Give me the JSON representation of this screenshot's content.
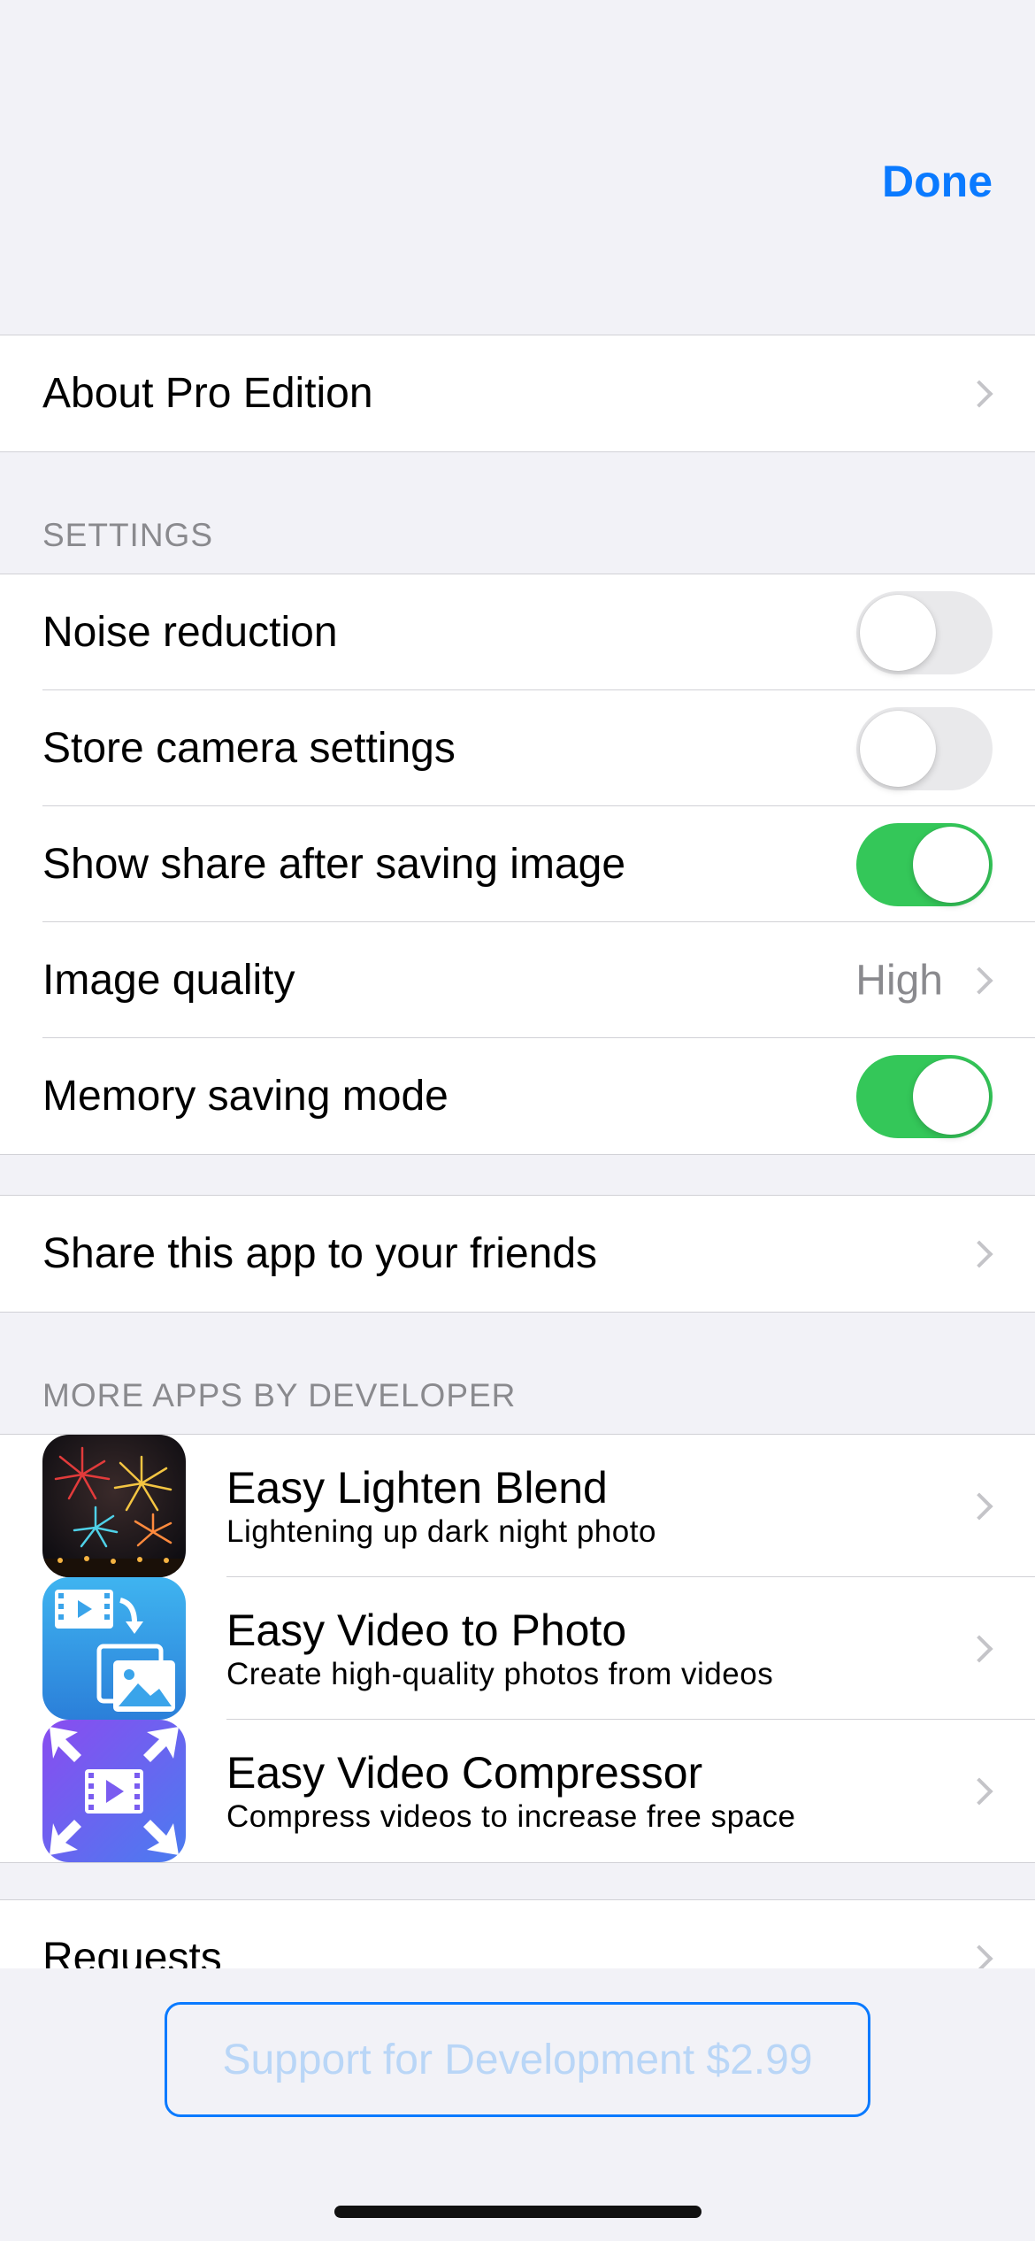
{
  "header": {
    "done_label": "Done"
  },
  "about": {
    "label": "About Pro Edition"
  },
  "settings": {
    "header": "SETTINGS",
    "items": [
      {
        "label": "Noise reduction",
        "toggle": false
      },
      {
        "label": "Store camera settings",
        "toggle": false
      },
      {
        "label": "Show share after saving image",
        "toggle": true
      },
      {
        "label": "Image quality",
        "value": "High"
      },
      {
        "label": "Memory saving mode",
        "toggle": true
      }
    ]
  },
  "share": {
    "label": "Share this app to your friends"
  },
  "more_apps": {
    "header": "MORE APPS BY DEVELOPER",
    "apps": [
      {
        "title": "Easy Lighten Blend",
        "subtitle": "Lightening up dark night photo",
        "icon": "fireworks-icon"
      },
      {
        "title": "Easy Video to Photo",
        "subtitle": "Create high-quality photos from videos",
        "icon": "video-to-photo-icon"
      },
      {
        "title": "Easy Video Compressor",
        "subtitle": "Compress videos to increase free space",
        "icon": "video-compressor-icon"
      }
    ]
  },
  "requests": {
    "label": "Requests"
  },
  "support": {
    "label": "Support for Development $2.99"
  },
  "colors": {
    "accent": "#0a7aff",
    "toggle_on": "#34c759",
    "toggle_off": "#e9e9eb",
    "background": "#f2f2f7",
    "secondary_text": "#8a8a8e"
  }
}
